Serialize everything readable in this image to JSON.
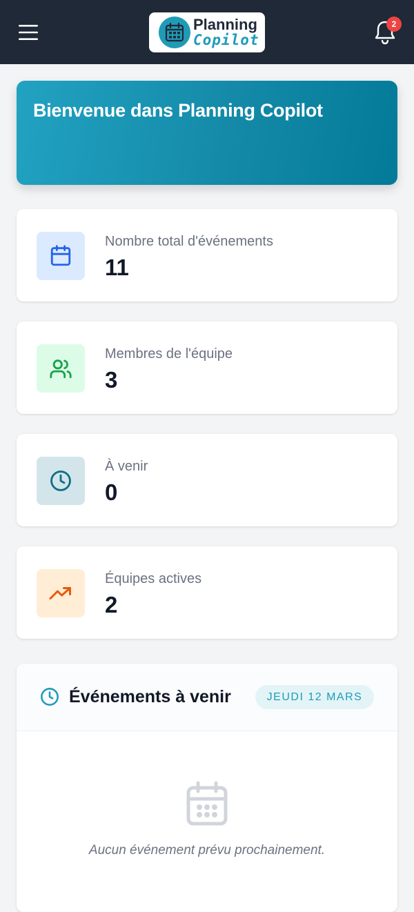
{
  "header": {
    "menu_icon": "hamburger-menu-icon",
    "logo": {
      "line1": "Planning",
      "line2": "Copilot",
      "icon": "calendar-logo-icon"
    },
    "notifications": {
      "icon": "bell-icon",
      "count": "2"
    }
  },
  "hero": {
    "title": "Bienvenue dans Planning Copilot"
  },
  "stats": [
    {
      "label": "Nombre total d'événements",
      "value": "11",
      "icon": "calendar-icon",
      "icon_bg": "#dbeafe",
      "icon_color": "#2563eb"
    },
    {
      "label": "Membres de l'équipe",
      "value": "3",
      "icon": "users-icon",
      "icon_bg": "#dcfce7",
      "icon_color": "#16a34a"
    },
    {
      "label": "À venir",
      "value": "0",
      "icon": "clock-icon",
      "icon_bg": "#d3e5ea",
      "icon_color": "#0f6f86"
    },
    {
      "label": "Équipes actives",
      "value": "2",
      "icon": "trending-up-icon",
      "icon_bg": "#ffedd5",
      "icon_color": "#ea580c"
    }
  ],
  "events": {
    "title": "Événements à venir",
    "date_badge": "JEUDI 12 MARS",
    "empty_message": "Aucun événement prévu prochainement.",
    "header_icon": "clock-icon",
    "empty_icon": "calendar-empty-icon"
  },
  "colors": {
    "topbar": "#1f2937",
    "accent": "#1f9bb8",
    "badge": "#ef4444",
    "background": "#f3f4f6"
  }
}
